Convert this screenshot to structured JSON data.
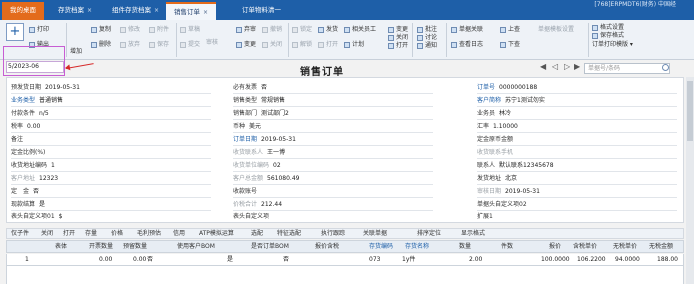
{
  "tabs": [
    {
      "label": "我的桌面"
    },
    {
      "label": "存货档案"
    },
    {
      "label": "组件存货档案"
    },
    {
      "label": "销售订单"
    },
    {
      "label": "订单物料清一"
    }
  ],
  "title_right": "[768]ERPMDT6(财务) 中国经",
  "toolbar": {
    "print": "打印",
    "output": "输出",
    "add": "增加",
    "copy": "复制",
    "modify": "修改",
    "attach": "附件",
    "delete": "删除",
    "abandon": "放弃",
    "save": "保存",
    "draft": "草稿",
    "submit": "提交",
    "approve": "审核",
    "cancel_approve": "弃审",
    "change": "变更",
    "recall": "撤销",
    "close": "关闭",
    "open": "打开",
    "lock": "锁定",
    "unlock": "解锁",
    "ship": "发货",
    "related_staff": "相关员工",
    "plan": "计划",
    "modify2": "变更",
    "close2": "关闭",
    "open2": "打开",
    "batch_notice": "批注",
    "discuss": "讨论",
    "notify": "通知",
    "bill_link": "单据关联",
    "view_log": "查看日志",
    "up": "上查",
    "down": "下查",
    "bill_template": "单据模板设置",
    "format_settings": "格式设置",
    "save_format": "保存格式",
    "order_print_template": "订单打印模版"
  },
  "date_cell": "5/2023-06",
  "doc_title": "销售订单",
  "search_placeholder": "单据号/条码",
  "form": {
    "pre_ship_date_label": "预发货日期",
    "pre_ship_date": "2019-05-31",
    "inv_label": "必有发票",
    "inv": "否",
    "order_no_label": "订单号",
    "order_no": "0000000188",
    "biz_type_label": "业务类型",
    "biz_type": "普通销售",
    "sales_type_label": "销售类型",
    "sales_type": "常规销售",
    "customer_label": "客户简称",
    "customer": "苏宁1测试勿实",
    "pay_term_label": "付款条件",
    "pay_term": "n/5",
    "sales_dept_label": "销售部门",
    "sales_dept": "测试部门2",
    "salesman_label": "业务员",
    "salesman": "林冷",
    "tax_rate_label": "税率",
    "tax_rate": "0.00",
    "currency_label": "币种",
    "currency": "美元",
    "exchange_label": "汇率",
    "exchange": "1.10000",
    "remark_label": "备注",
    "remark": "",
    "order_date_label": "订单日期",
    "order_date": "2019-05-31",
    "deposit_total_label": "定金原币金额",
    "deposit_total": "",
    "deposit_ratio_label": "定金比例(%)",
    "deposit_ratio": "",
    "receiver_label": "收货联系人",
    "receiver": "王一博",
    "receiver_mobile_label": "收货联系手机",
    "receiver_mobile": "",
    "recv_addr_code_label": "收货地址编码",
    "recv_addr_code": "1",
    "contract_code_label": "收货单位编码",
    "contract_code": "02",
    "contact_label": "联系人",
    "contact": "默认联系12345678",
    "customer_addr_label": "客户地址",
    "customer_addr": "12323",
    "customer_total_label": "客户总金额",
    "customer_total": "561080.49",
    "ship_addr_label": "发货地址",
    "ship_addr": "北京",
    "deposit_label": "定　金",
    "deposit": "否",
    "recv_account_label": "收款账号",
    "recv_account": "",
    "approve_date_label": "审核日期",
    "approve_date": "2019-05-31",
    "inv_settle_label": "现款结算",
    "inv_settle": "是",
    "price_total_label": "价税合计",
    "price_total": "212.44",
    "header_custom2_label": "单据头自定义项02",
    "header_custom2": "",
    "header_custom1_label": "表头自定义项01",
    "header_custom1": "$",
    "header_custom_label": "表头自定义项",
    "header_custom": "",
    "ext1_label": "扩展1",
    "ext1": ""
  },
  "grid_toolbar": [
    "仅子件",
    "关闭",
    "打开",
    "存量",
    "价格",
    "毛利预估",
    "信用",
    "ATP模拟运算",
    "选配",
    "特征选配",
    "执行跟踪",
    "关联单据",
    "排序定位",
    "显示格式"
  ],
  "grid_columns": [
    "表体",
    "开票数量",
    "预留数量",
    "使用客户BOM",
    "是否订单BOM",
    "报价含税",
    "存货编码",
    "存货名称",
    "数量",
    "件数",
    "报价",
    "含税单价",
    "无税单价",
    "无税金额"
  ],
  "grid_rows": [
    {
      "no": "1",
      "open_qty": "0.00",
      "reserve_qty": "0.00",
      "use_bom": "否",
      "order_bom": "是",
      "quote_tax": "否",
      "inv_code": "073",
      "inv_name": "1y件",
      "qty": "2.00",
      "pieces": "",
      "quote": "100.0000",
      "tax_price": "106.2200",
      "notax_price": "94.0000",
      "notax_amount": "188.00"
    }
  ]
}
